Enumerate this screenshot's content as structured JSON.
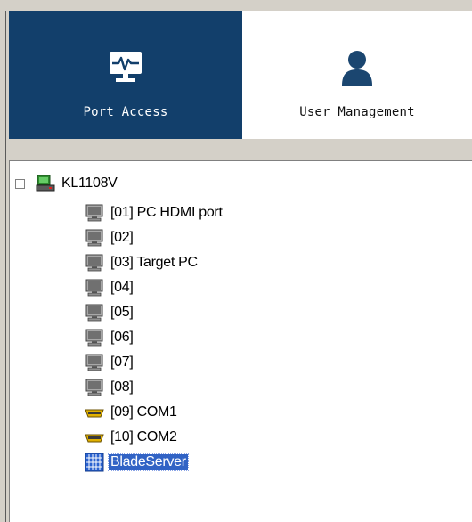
{
  "tabs": [
    {
      "label": "Port Access",
      "icon": "monitor-pulse-icon",
      "active": true
    },
    {
      "label": "User Management",
      "icon": "user-icon",
      "active": false
    }
  ],
  "tree": {
    "root": {
      "label": "KL1108V",
      "icon": "kvm-switch-icon",
      "expanded": true
    },
    "items": [
      {
        "label": "[01] PC HDMI port",
        "icon": "computer-icon"
      },
      {
        "label": "[02]",
        "icon": "computer-icon"
      },
      {
        "label": "[03] Target PC",
        "icon": "computer-icon"
      },
      {
        "label": "[04]",
        "icon": "computer-icon"
      },
      {
        "label": "[05]",
        "icon": "computer-icon"
      },
      {
        "label": "[06]",
        "icon": "computer-icon"
      },
      {
        "label": "[07]",
        "icon": "computer-icon"
      },
      {
        "label": "[08]",
        "icon": "computer-icon"
      },
      {
        "label": "[09] COM1",
        "icon": "serial-port-icon"
      },
      {
        "label": "[10] COM2",
        "icon": "serial-port-icon"
      },
      {
        "label": "BladeServer",
        "icon": "blade-server-icon",
        "selected": true
      }
    ]
  },
  "colors": {
    "active_tab": "#123f6b",
    "selection": "#3163c5"
  }
}
